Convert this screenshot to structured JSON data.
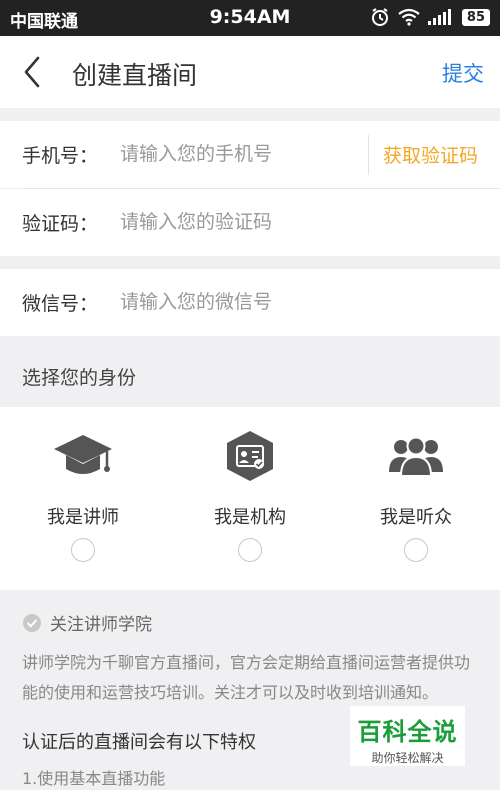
{
  "status_bar": {
    "carrier": "中国联通",
    "time": "9:54AM",
    "battery": "85"
  },
  "nav": {
    "title": "创建直播间",
    "submit": "提交",
    "back_icon": "back-arrow-icon"
  },
  "form": {
    "phone": {
      "label": "手机号：",
      "placeholder": "请输入您的手机号",
      "code_button": "获取验证码"
    },
    "code": {
      "label": "验证码：",
      "placeholder": "请输入您的验证码"
    },
    "wechat": {
      "label": "微信号：",
      "placeholder": "请输入您的微信号"
    }
  },
  "identity": {
    "title": "选择您的身份",
    "options": [
      {
        "label": "我是讲师",
        "icon": "graduation-cap-icon"
      },
      {
        "label": "我是机构",
        "icon": "organization-badge-icon"
      },
      {
        "label": "我是听众",
        "icon": "audience-group-icon"
      }
    ]
  },
  "follow": {
    "label": "关注讲师学院",
    "checked": true
  },
  "description": "讲师学院为千聊官方直播间，官方会定期给直播间运营者提供功能的使用和运营技巧培训。关注才可以及时收到培训通知。",
  "privileges": {
    "title": "认证后的直播间会有以下特权",
    "items": [
      "1.使用基本直播功能"
    ]
  },
  "watermark": {
    "title": "百科全说",
    "subtitle": "助你轻松解决"
  },
  "colors": {
    "accent_blue": "#2b7fe0",
    "accent_orange": "#f5a623",
    "icon_gray": "#555555",
    "watermark_green": "#1a9e3a"
  }
}
